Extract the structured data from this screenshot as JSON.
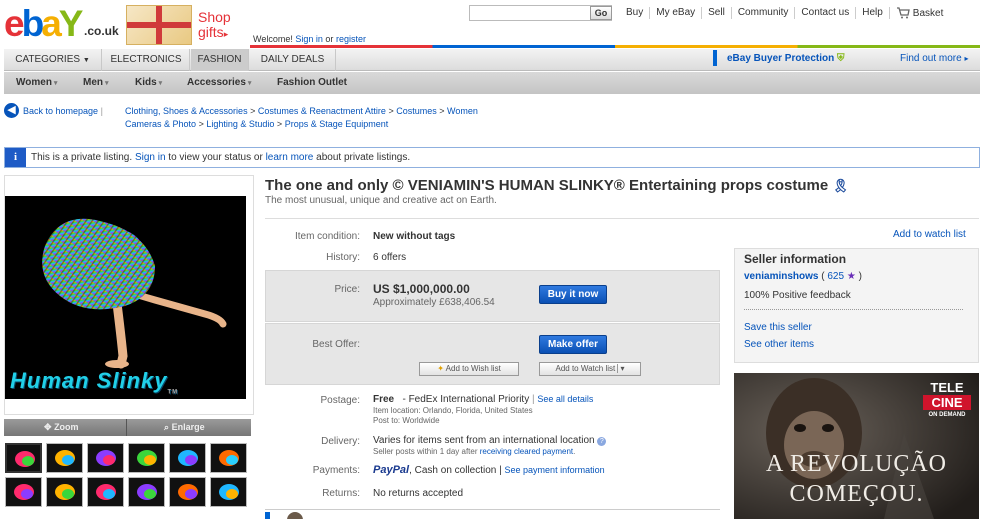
{
  "header": {
    "logo_letters": [
      "e",
      "b",
      "a",
      "Y"
    ],
    "logo_suffix": ".co.uk",
    "promo": [
      "Shop",
      "gifts"
    ],
    "promo_arrow": "▸",
    "welcome": "Welcome!",
    "sign_in": "Sign in",
    "or": "or",
    "register": "register",
    "go_label": "Go",
    "links": [
      "Buy",
      "My eBay",
      "Sell",
      "Community",
      "Contact us",
      "Help"
    ],
    "basket": "Basket"
  },
  "nav": {
    "tabs": [
      "CATEGORIES",
      "ELECTRONICS",
      "FASHION",
      "DAILY DEALS"
    ],
    "selected_tab": "FASHION",
    "buyer_protection": "eBay Buyer Protection",
    "find_out_more": "Find out more",
    "sub_items": [
      "Women",
      "Men",
      "Kids",
      "Accessories",
      "Fashion Outlet"
    ]
  },
  "breadcrumb": {
    "back": "Back to homepage",
    "line1": [
      "Clothing, Shoes & Accessories",
      "Costumes & Reenactment Attire",
      "Costumes",
      "Women"
    ],
    "line2": [
      "Cameras & Photo",
      "Lighting & Studio",
      "Props & Stage Equipment"
    ],
    "separator": ">"
  },
  "notice": {
    "icon": "i",
    "before": "This is a private listing.",
    "sign_in": "Sign in",
    "middle": "to view your status or",
    "learn_more": "learn more",
    "after": "about private listings."
  },
  "gallery": {
    "photo_caption": "Human Slinky",
    "tm": "TM",
    "zoom": "Zoom",
    "enlarge": "Enlarge",
    "thumb_count": 12
  },
  "item": {
    "title": "The one and only © VENIAMIN'S HUMAN SLINKY® Entertaining props costume",
    "subtitle": "The most unusual, unique and creative act on Earth.",
    "add_watch": "Add to watch list",
    "condition_label": "Item condition:",
    "condition": "New without tags",
    "history_label": "History:",
    "history": "6 offers",
    "price_label": "Price:",
    "price": "US $1,000,000.00",
    "price_approx": "Approximately £638,406.54",
    "buy_now": "Buy it now",
    "best_offer_label": "Best Offer:",
    "make_offer": "Make offer",
    "add_wish": "Add to Wish list",
    "add_watch_btn": "Add to Watch list",
    "postage_label": "Postage:",
    "postage_free": "Free",
    "postage_service": "- FedEx International Priority",
    "see_all": "See all details",
    "item_location": "Item location: Orlando, Florida, United States",
    "post_to": "Post to: Worldwide",
    "delivery_label": "Delivery:",
    "delivery": "Varies for items sent from an international location",
    "delivery_note_pre": "Seller posts within 1 day after",
    "delivery_note_link": "receiving cleared payment",
    "delivery_note_post": ".",
    "payments_label": "Payments:",
    "paypal": "PayPal",
    "payments_rest": ", Cash on collection |",
    "see_payment": "See payment information",
    "returns_label": "Returns:",
    "returns": "No returns accepted"
  },
  "seller": {
    "heading": "Seller information",
    "name": "veniaminshows",
    "score": "625",
    "feedback": "100% Positive feedback",
    "save": "Save this seller",
    "other": "See other items"
  },
  "ad": {
    "brand1": "TELE",
    "brand2": "CINE",
    "brand3": "ON DEMAND",
    "line1": "A REVOLUÇÃO",
    "line2": "COMEÇOU."
  },
  "colors": {
    "ebay_red": "#e53238",
    "ebay_blue": "#0064d2",
    "ebay_yellow": "#f5af02",
    "ebay_green": "#86b817",
    "link": "#0654ba"
  }
}
